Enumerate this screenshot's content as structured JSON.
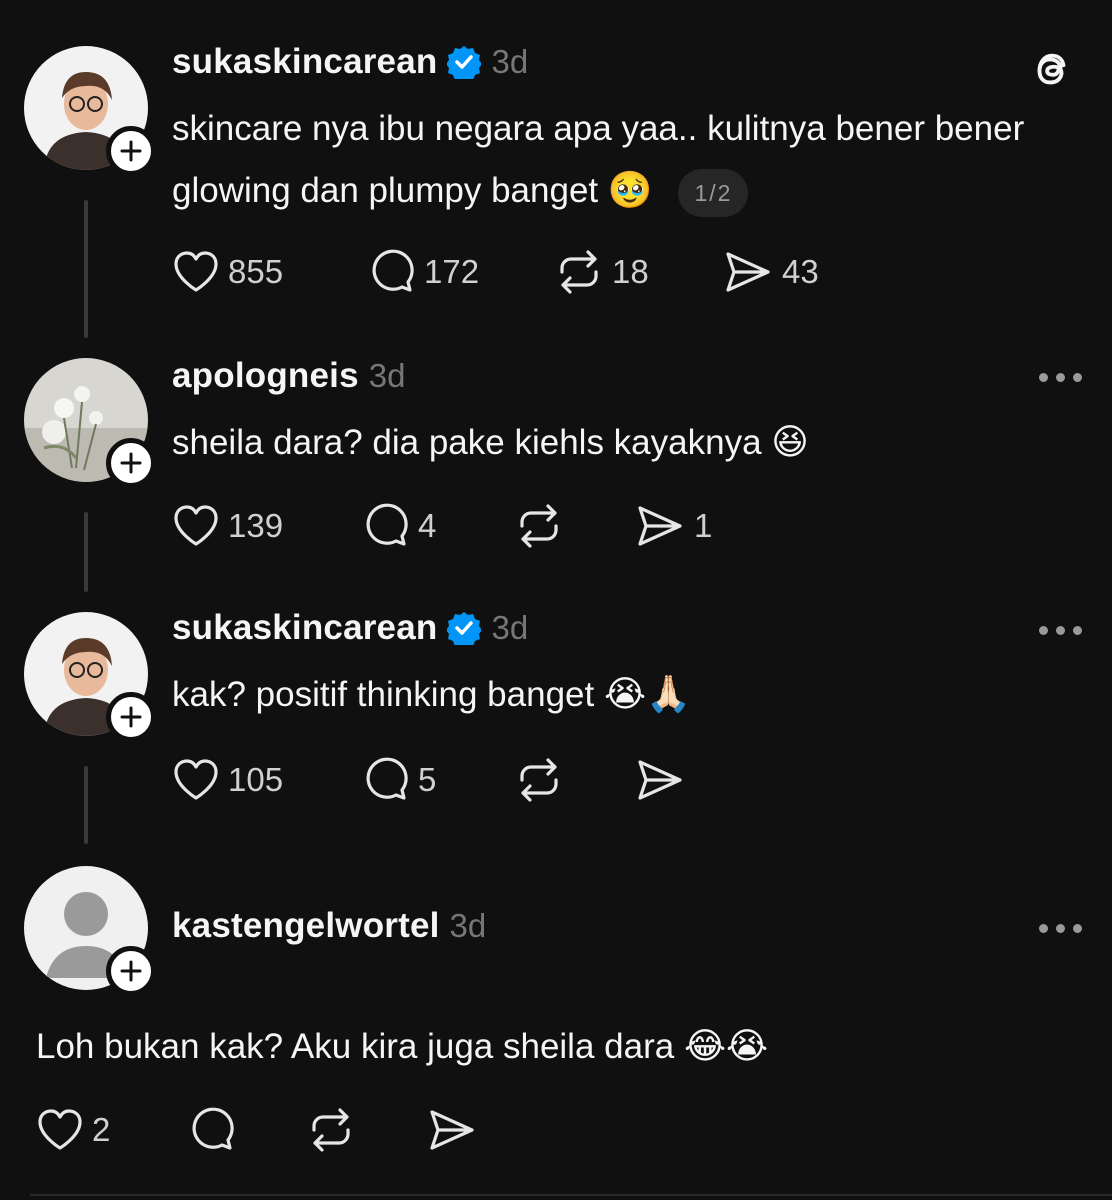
{
  "posts": [
    {
      "username": "sukaskincarean",
      "verified": true,
      "time": "3d",
      "text": "skincare nya ibu negara apa yaa.. kulitnya bener bener glowing dan plumpy banget",
      "emoji": "🥹",
      "page_indicator": "1/2",
      "likes": "855",
      "replies": "172",
      "reposts": "18",
      "shares": "43"
    },
    {
      "username": "apologneis",
      "verified": false,
      "time": "3d",
      "text": "sheila dara? dia pake kiehls kayaknya",
      "emoji": "😆",
      "likes": "139",
      "replies": "4",
      "reposts": "",
      "shares": "1"
    },
    {
      "username": "sukaskincarean",
      "verified": true,
      "time": "3d",
      "text": "kak? positif thinking banget",
      "emoji": "😭🙏🏻",
      "likes": "105",
      "replies": "5",
      "reposts": "",
      "shares": ""
    },
    {
      "username": "kastengelwortel",
      "verified": false,
      "time": "3d",
      "text": "Loh bukan kak? Aku kira juga sheila dara",
      "emoji": "😂😭",
      "likes": "2",
      "replies": "",
      "reposts": "",
      "shares": ""
    }
  ],
  "icons": {
    "app_logo": "threads-logo-icon",
    "verified": "verified-badge-icon",
    "like": "heart-icon",
    "reply": "comment-icon",
    "repost": "repost-icon",
    "share": "send-icon",
    "follow": "plus-icon",
    "more": "more-options-icon"
  },
  "colors": {
    "background": "#101010",
    "text": "#f3f5f7",
    "muted": "#777777",
    "verified": "#0095f6"
  }
}
